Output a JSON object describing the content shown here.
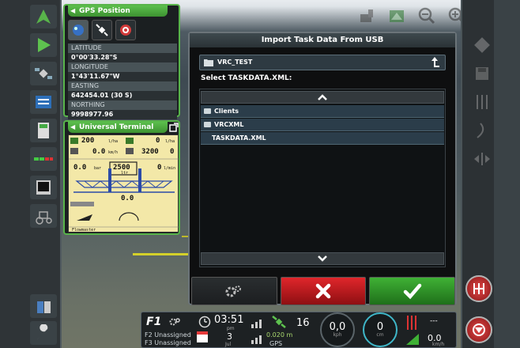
{
  "gps_panel": {
    "title": "GPS Position",
    "rows": [
      {
        "label": "LATITUDE",
        "value": "0°00'33.28\"S"
      },
      {
        "label": "LONGITUDE",
        "value": "1°43'11.67\"W"
      },
      {
        "label": "EASTING",
        "value": "642454.01 (30 S)"
      },
      {
        "label": "NORTHING",
        "value": "9998977.96"
      }
    ]
  },
  "ut_panel": {
    "title": "Universal Terminal",
    "screen": {
      "rate1": "200",
      "rate1_unit": "l/ha",
      "rate1_b": "0",
      "rate1_b_unit": "l/ha",
      "speed": "0.0",
      "speed_unit": "km/h",
      "rpm": "3200",
      "rpm_b": "0",
      "pressure": "0.0",
      "pressure_unit": "bar",
      "tank": "2500",
      "tank_unit": "ltr",
      "flow": "0",
      "flow_unit": "l/min",
      "boom_val": "0.0",
      "footer": "Flowmaster"
    }
  },
  "dialog": {
    "title": "Import Task Data From USB",
    "path": "VRC_TEST",
    "select_label": "Select TASKDATA.XML:",
    "items": [
      {
        "label": "Clients",
        "type": "folder"
      },
      {
        "label": "VRCXML",
        "type": "folder"
      },
      {
        "label": "TASKDATA.XML",
        "type": "file"
      }
    ]
  },
  "bottom_bar": {
    "f1": "F1",
    "unassigned_1": "Unassigned",
    "unassigned_2": "Unassigned",
    "f2": "F2",
    "f3": "F3",
    "time": "03:51",
    "ampm": "pm",
    "day": "3",
    "month": "Jul",
    "sat_count": "16",
    "distance": "0.020 m",
    "gps_label": "GPS",
    "gauge1_val": "0,0",
    "gauge1_unit": "kph",
    "gauge2_val": "0",
    "gauge2_unit": "cm",
    "dash": "---",
    "speed": "0.0",
    "speed_unit": "km/h"
  },
  "colors": {
    "accent_green": "#58b44a",
    "cancel_red": "#e0262b",
    "ok_green": "#3fb135",
    "list_bg": "#2b3d4a"
  }
}
